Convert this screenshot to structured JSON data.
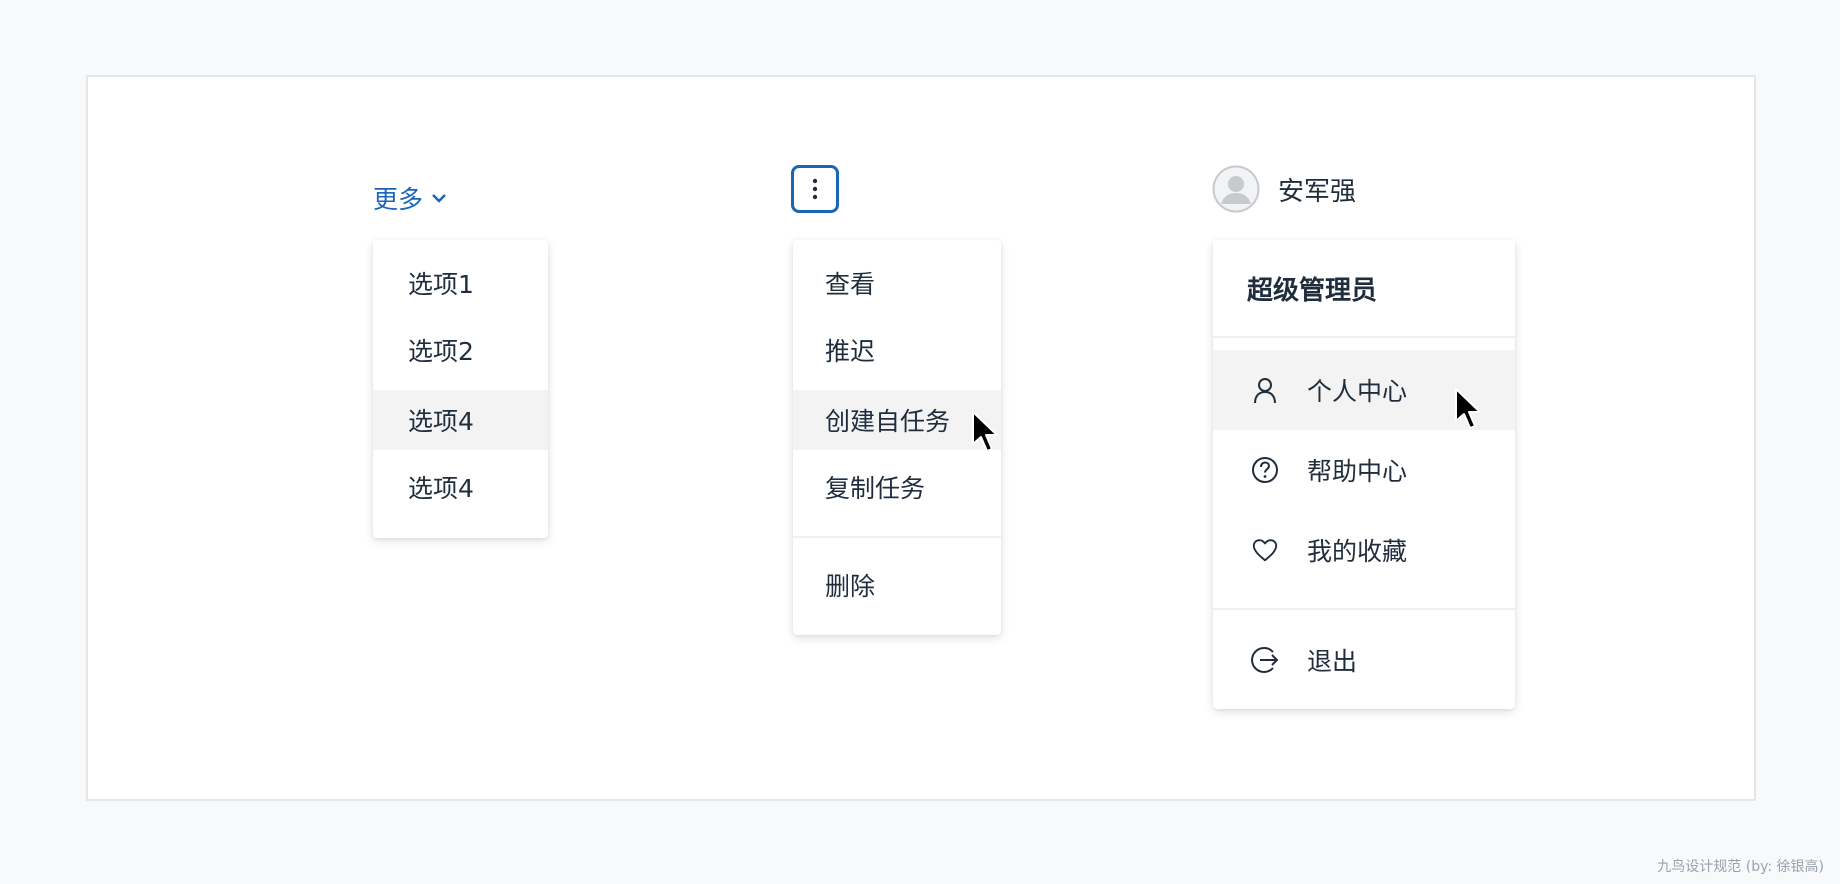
{
  "menu1": {
    "trigger_label": "更多",
    "items": [
      "选项1",
      "选项2",
      "选项4",
      "选项4"
    ]
  },
  "menu2": {
    "items": [
      "查看",
      "推迟",
      "创建自任务",
      "复制任务"
    ],
    "delete_label": "删除"
  },
  "menu3": {
    "user_name": "安军强",
    "role": "超级管理员",
    "items": [
      {
        "label": "个人中心",
        "icon": "user-icon"
      },
      {
        "label": "帮助中心",
        "icon": "help-icon"
      },
      {
        "label": "我的收藏",
        "icon": "heart-icon"
      }
    ],
    "logout_label": "退出"
  },
  "footer": "九鸟设计规范 (by: 徐银高)",
  "colors": {
    "accent": "#1b65b9",
    "text": "#1f2d3d",
    "highlight": "#f3f3f3"
  }
}
